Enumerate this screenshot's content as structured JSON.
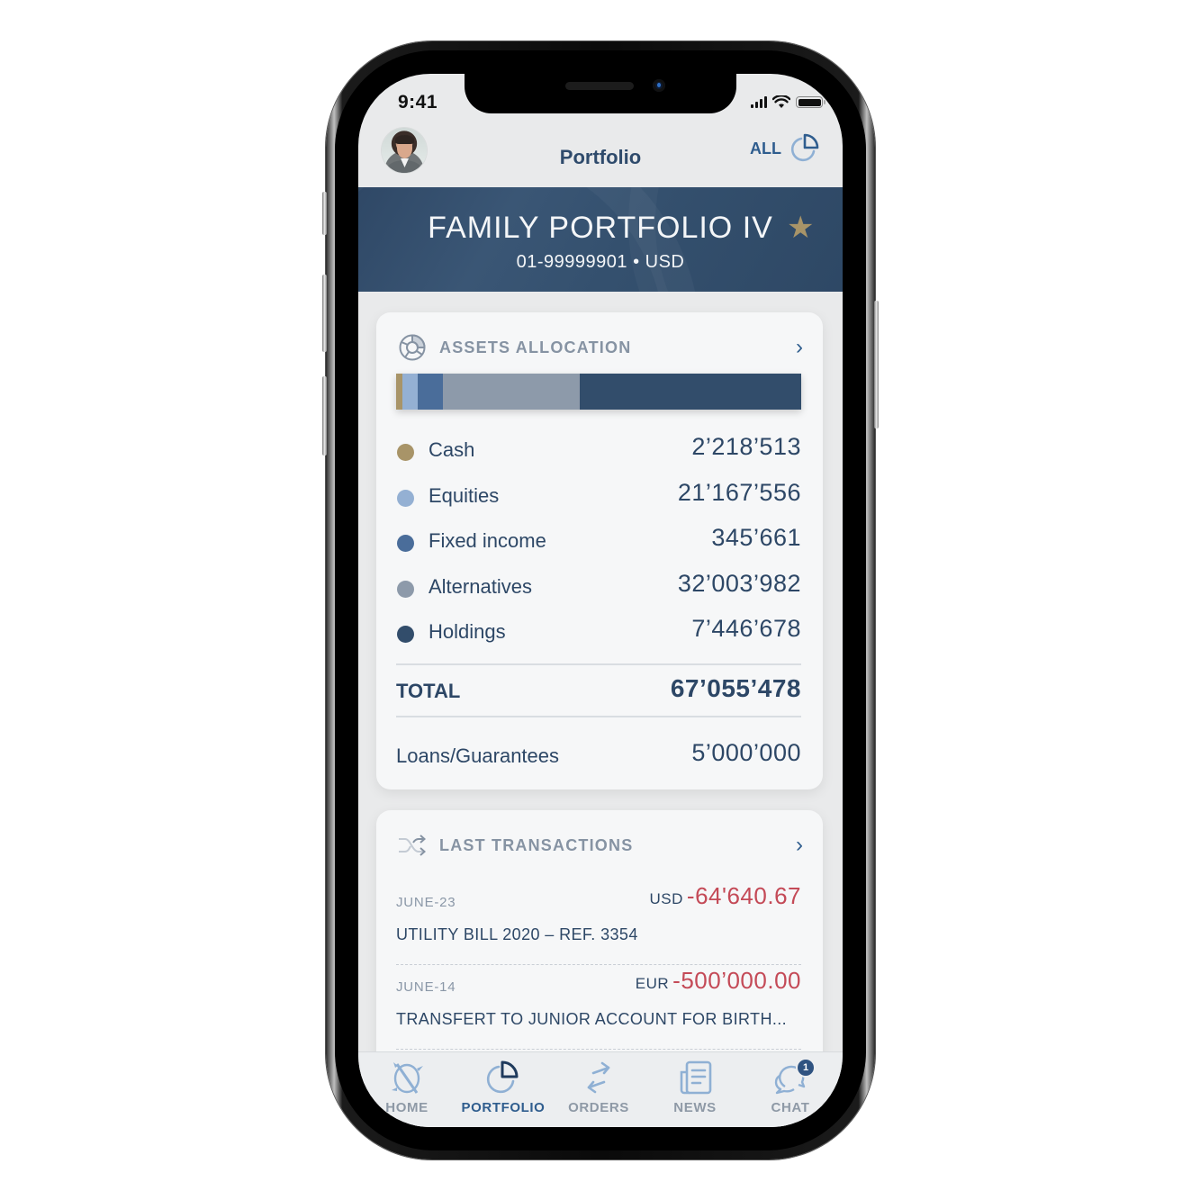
{
  "status_bar": {
    "time": "9:41"
  },
  "header": {
    "title": "Portfolio",
    "filter_label": "ALL",
    "avatar_alt": "user-avatar"
  },
  "banner": {
    "portfolio_name": "FAMILY PORTFOLIO IV",
    "account": "01-99999901 • USD",
    "favorite": true
  },
  "assets_allocation": {
    "title": "ASSETS ALLOCATION",
    "items": [
      {
        "label": "Cash",
        "value": "2’218’513",
        "color": "#a89468",
        "share_pct": 1.6
      },
      {
        "label": "Equities",
        "value": "21’167’556",
        "color": "#94b0d3",
        "share_pct": 3.8
      },
      {
        "label": "Fixed income",
        "value": "345’661",
        "color": "#4a6d9a",
        "share_pct": 6.2
      },
      {
        "label": "Alternatives",
        "value": "32’003’982",
        "color": "#8d9aaa",
        "share_pct": 33.8
      },
      {
        "label": "Holdings",
        "value": "7’446’678",
        "color": "#324d6b",
        "share_pct": 54.6
      }
    ],
    "total_label": "TOTAL",
    "total_value": "67’055’478",
    "loans_label": "Loans/Guarantees",
    "loans_value": "5’000’000"
  },
  "last_transactions": {
    "title": "LAST TRANSACTIONS",
    "items": [
      {
        "date": "JUNE-23",
        "currency": "USD",
        "amount": "-64'640.67",
        "description": "UTILITY BILL 2020 – REF. 3354"
      },
      {
        "date": "JUNE-14",
        "currency": "EUR",
        "amount": "-500’000.00",
        "description": "TRANSFERT TO JUNIOR ACCOUNT FOR BIRTH..."
      }
    ]
  },
  "tabbar": {
    "tabs": [
      {
        "label": "HOME",
        "icon": "home-compass-icon",
        "active": false
      },
      {
        "label": "PORTFOLIO",
        "icon": "pie-chart-icon",
        "active": true
      },
      {
        "label": "ORDERS",
        "icon": "swap-arrows-icon",
        "active": false
      },
      {
        "label": "NEWS",
        "icon": "newspaper-icon",
        "active": false
      },
      {
        "label": "CHAT",
        "icon": "chat-bubbles-icon",
        "active": false,
        "badge": "1"
      }
    ]
  },
  "colors": {
    "brand_navy": "#324d6b",
    "accent_blue": "#2f5d8e",
    "negative_red": "#c44a57",
    "gold": "#a89468"
  }
}
